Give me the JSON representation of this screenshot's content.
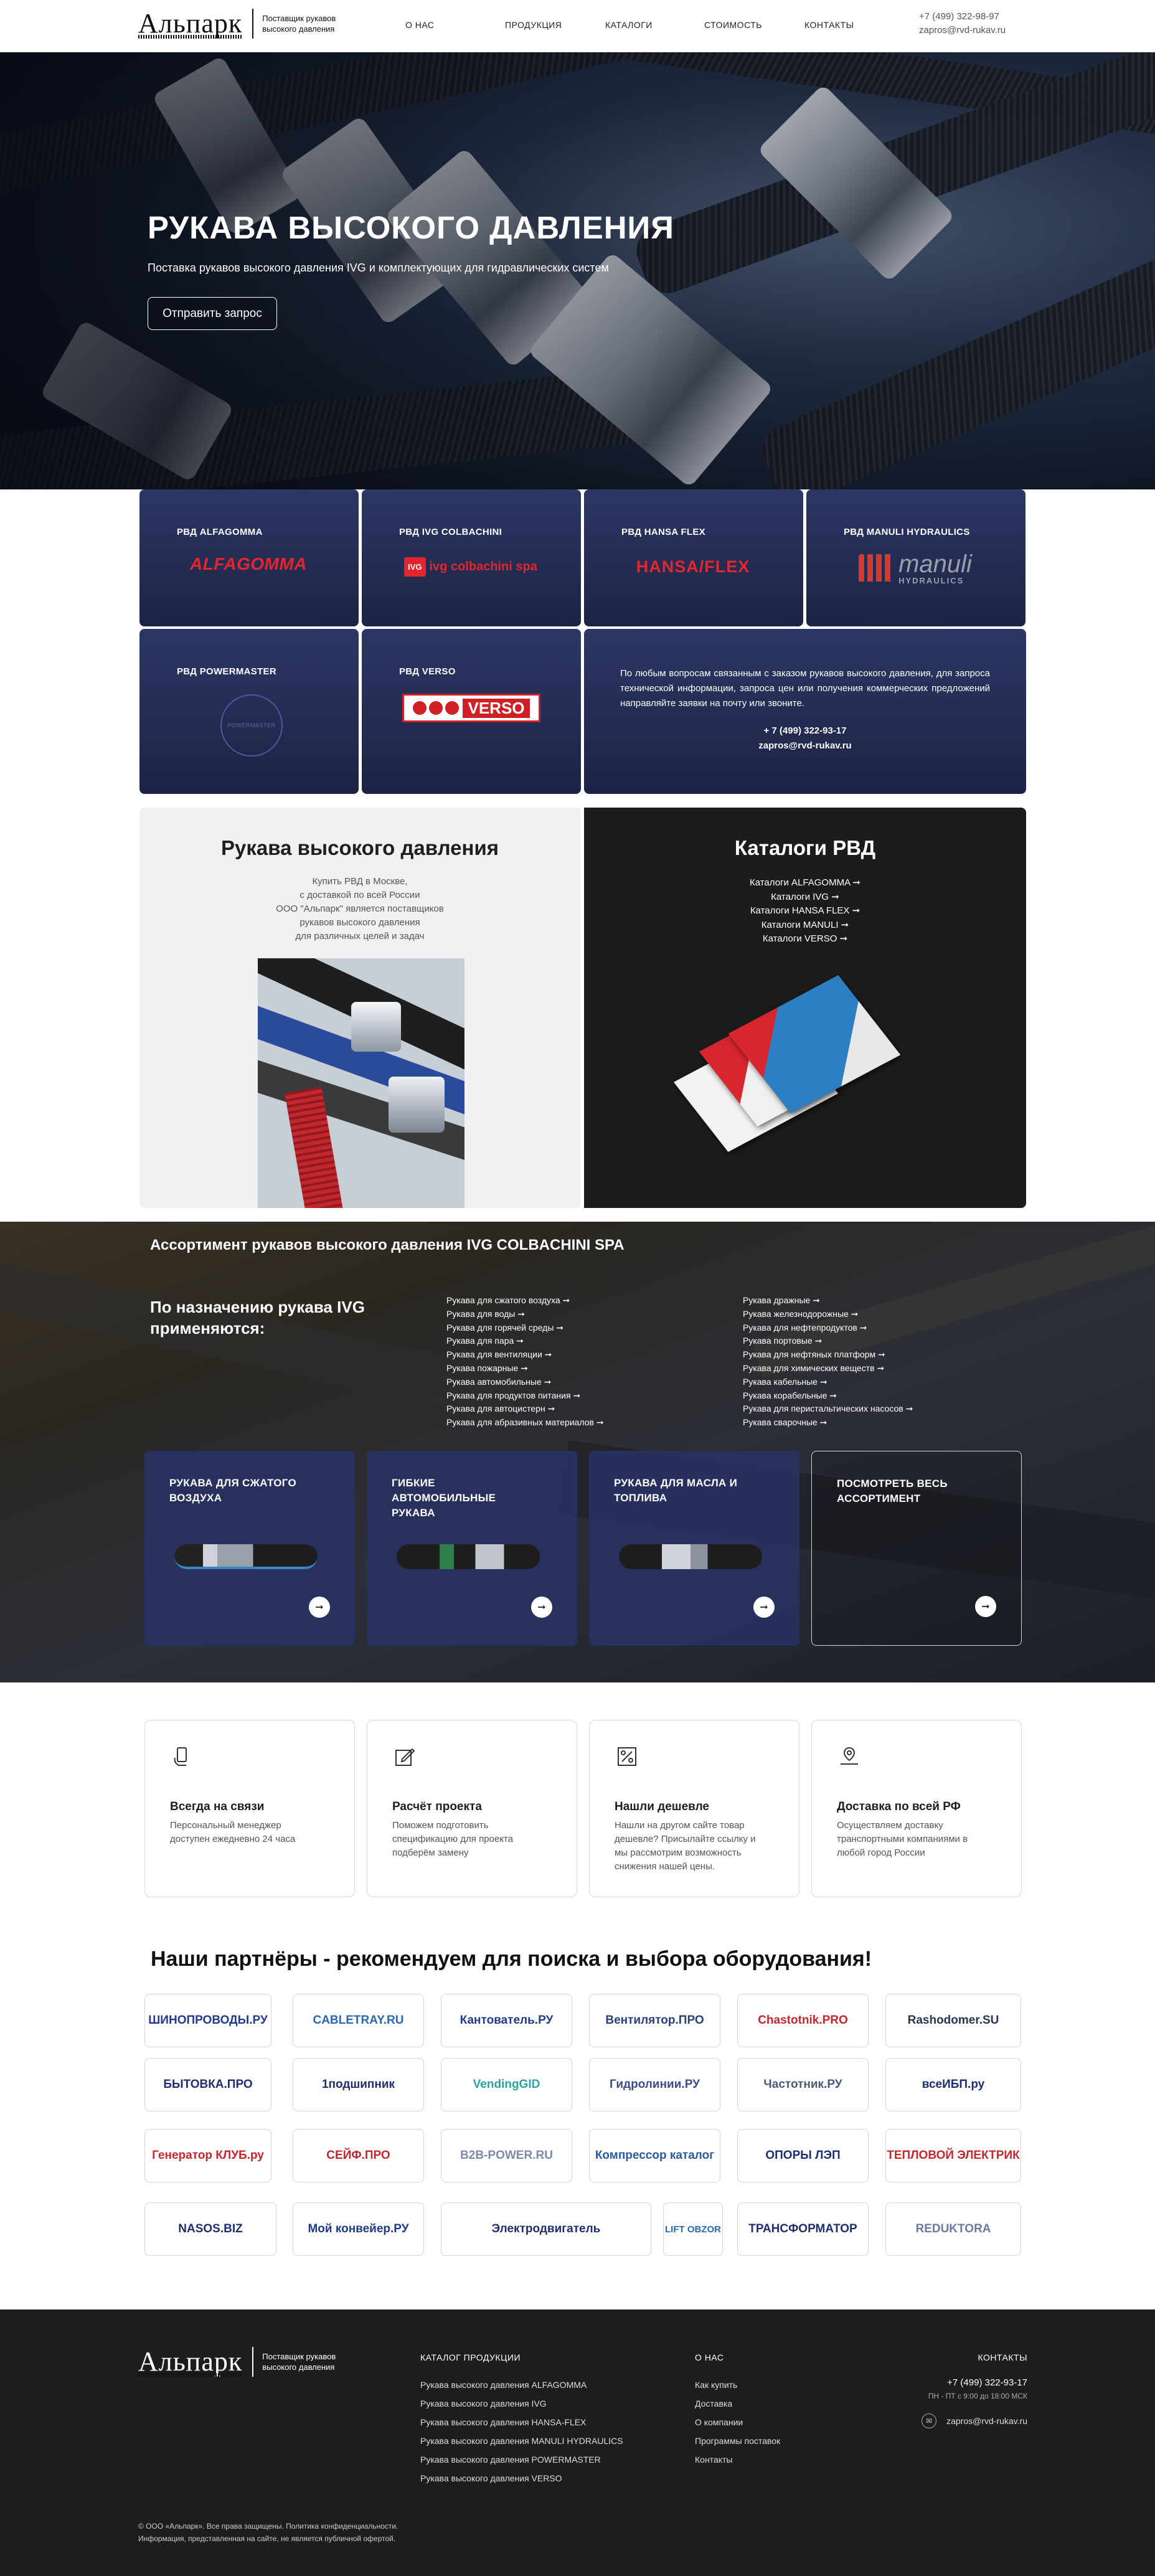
{
  "header": {
    "brand": "Альпарк",
    "tagline": "Поставщик рукавов высокого давления",
    "nav": [
      "О НАС",
      "ПРОДУКЦИЯ",
      "КАТАЛОГИ",
      "СТОИМОСТЬ",
      "КОНТАКТЫ"
    ],
    "phone": "+7 (499) 322-98-97",
    "email": "zapros@rvd-rukav.ru"
  },
  "hero": {
    "title": "РУКАВА ВЫСОКОГО ДАВЛЕНИЯ",
    "subtitle": "Поставка рукавов высокого давления IVG и комплектующих для гидравлических систем",
    "button": "Отправить запрос"
  },
  "brands": [
    {
      "title": "РВД ALFAGOMMA",
      "logo": "ALFAGOMMA",
      "color": "#e3262d"
    },
    {
      "title": "РВД IVG COLBACHINI",
      "logo": "ivg colbachini spa",
      "color": "#e3262d"
    },
    {
      "title": "РВД HANSA FLEX",
      "logo": "HANSA/FLEX",
      "color": "#e3262d"
    },
    {
      "title": "РВД MANULI HYDRAULICS",
      "logo": "manuli",
      "logo_sub": "HYDRAULICS",
      "color": "#d23a2d"
    },
    {
      "title": "РВД POWERMASTER",
      "logo": "POWERMASTER",
      "color": "#4a5a9a"
    },
    {
      "title": "РВД VERSO",
      "logo": "VERSO",
      "color": "#d11f26"
    }
  ],
  "info": {
    "text": "По любым вопросам связанным с заказом рукавов высокого давления, для запроса технической информации, запроса цен или получения коммерческих предложений направляйте заявки на почту или звоните.",
    "phone": "+ 7 (499) 322-93-17",
    "email": "zapros@rvd-rukav.ru"
  },
  "split": {
    "left_title": "Рукава высокого давления",
    "left_lines": [
      "Купить РВД в Москве,",
      "с доставкой по всей России",
      "ООО \"Альпарк\" является поставщиков",
      "рукавов высокого давления",
      "для различных целей и задач"
    ],
    "right_title": "Каталоги РВД",
    "catalogs": [
      "Каталоги ALFAGOMMA ➞",
      "Каталоги IVG ➞",
      "Каталоги HANSA FLEX ➞",
      "Каталоги MANULI ➞",
      "Каталоги VERSO ➞"
    ]
  },
  "assortment": {
    "title": "Ассортимент рукавов высокого давления IVG COLBACHINI SPA",
    "heading": "По назначению рукава IVG применяются:",
    "col1": [
      "Рукава для сжатого воздуха ➞",
      "Рукава для воды ➞",
      "Рукава для горячей среды ➞",
      "Рукава для пара ➞",
      "Рукава для вентиляции ➞",
      "Рукава пожарные ➞",
      "Рукава автомобильные ➞",
      "Рукава для продуктов питания ➞",
      "Рукава для автоцистерн ➞",
      "Рукава для абразивных материалов ➞"
    ],
    "col2": [
      "Рукава дражные ➞",
      "Рукава железнодорожные ➞",
      "Рукава для нефтепродуктов ➞",
      "Рукава портовые ➞",
      "Рукава для нефтяных платформ ➞",
      "Рукава для химических веществ ➞",
      "Рукава кабельные ➞",
      "Рукава корабельные ➞",
      "Рукава для перистальтических насосов ➞",
      "Рукава сварочные ➞"
    ],
    "cards": [
      "РУКАВА ДЛЯ СЖАТОГО ВОЗДУХА",
      "ГИБКИЕ АВТОМОБИЛЬНЫЕ РУКАВА",
      "РУКАВА ДЛЯ МАСЛА И ТОПЛИВА",
      "ПОСМОТРЕТЬ ВЕСЬ АССОРТИМЕНТ"
    ]
  },
  "features": [
    {
      "title": "Всегда на связи",
      "text": "Персональный менеджер доступен ежедневно 24 часа",
      "icon": "hand-phone-icon"
    },
    {
      "title": "Расчёт проекта",
      "text": "Поможем подготовить спецификацию для проекта подберём замену",
      "icon": "edit-icon"
    },
    {
      "title": "Нашли дешевле",
      "text": "Нашли на другом сайте товар дешевле? Присылайте ссылку и мы рассмотрим возможность снижения нашей цены.",
      "icon": "percent-icon"
    },
    {
      "title": "Доставка по всей РФ",
      "text": "Осуществляем доставку транспортными компаниями в любой город России",
      "icon": "delivery-icon"
    }
  ],
  "partners": {
    "title": "Наши партнёры - рекомендуем для поиска и выбора оборудования!",
    "items": [
      "ШИНОПРОВОДЫ.РУ",
      "CABLETRAY.RU",
      "Кантователь.РУ",
      "Вентилятор.ПРО",
      "Chastotnik.PRO",
      "Rashodomer.SU",
      "БЫТОВКА.ПРО",
      "1подшипник",
      "VendingGID",
      "Гидролинии.РУ",
      "Частотник.РУ",
      "всеИБП.ру",
      "Генератор КЛУБ.ру",
      "СЕЙФ.ПРО",
      "B2B-POWER.RU",
      "Компрессор каталог",
      "ОПОРЫ ЛЭП",
      "ТЕПЛОВОЙ ЭЛЕКТРИК",
      "NASOS.BIZ",
      "Мой конвейер.РУ",
      "Электродвигатель",
      "LIFT OBZOR",
      "ТРАНСФОРМАТОР",
      "REDUKTORA"
    ]
  },
  "footer": {
    "brand": "Альпарк",
    "tagline": "Поставщик рукавов высокого давления",
    "catalog_title": "КАТАЛОГ ПРОДУКЦИИ",
    "catalog": [
      "Рукава высокого давления ALFAGOMMA",
      "Рукава высокого давления IVG",
      "Рукава высокого давления HANSA-FLEX",
      "Рукава высокого давления MANULI HYDRAULICS",
      "Рукава высокого давления POWERMASTER",
      "Рукава высокого давления VERSO"
    ],
    "about_title": "О НАС",
    "about": [
      "Как купить",
      "Доставка",
      "О компании",
      "Программы поставок",
      "Контакты"
    ],
    "contacts_title": "КОНТАКТЫ",
    "phone": "+7 (499) 322-93-17",
    "hours": "ПН - ПТ с 9:00 до 18:00 МСК",
    "email": "zapros@rvd-rukav.ru",
    "copyright": "© ООО «Альпарк». Все права защищены. Политика конфиденциальности.",
    "disclaimer": "Информация, представленная на сайте, не является публичной офертой."
  },
  "colors": {
    "card_navy": "#2c3765",
    "accent_red": "#e3262d",
    "dark": "#1d1d1d"
  }
}
